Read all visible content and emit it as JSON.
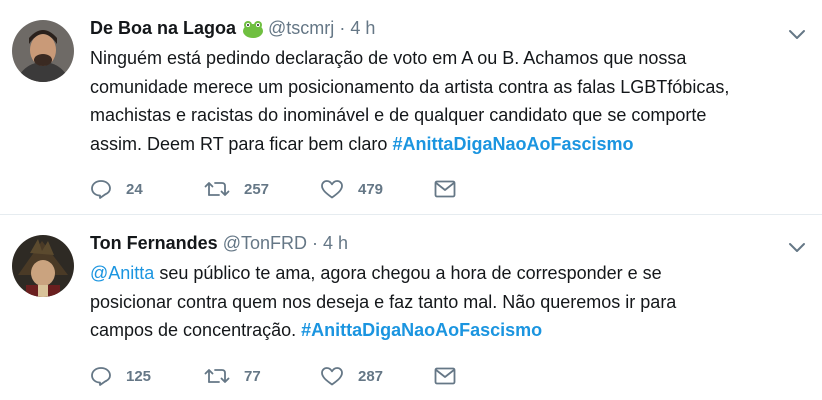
{
  "tweets": [
    {
      "name": "De Boa na Lagoa",
      "handle": "@tscmrj",
      "dot": "·",
      "time": "4 h",
      "lines": [
        "Ninguém está pedindo declaração de voto em A ou B. Achamos que nossa",
        "comunidade merece um posicionamento da artista contra as falas LGBTfóbicas,",
        "machistas e racistas do inominável e de qualquer candidato que se comporte"
      ],
      "last_line_prefix": "assim. Deem RT para ficar bem claro ",
      "hashtag": "#AnittaDigaNaoAoFascismo",
      "replies": "24",
      "retweets": "257",
      "likes": "479"
    },
    {
      "name": "Ton Fernandes",
      "handle": "@TonFRD",
      "dot": "·",
      "time": "4 h",
      "mention": "@Anitta",
      "line1_rest": " seu público te ama, agora chegou a hora de corresponder e se",
      "line2": "posicionar contra quem nos deseja e faz tanto mal. Não queremos ir para",
      "last_line_prefix": "campos de concentração. ",
      "hashtag": "#AnittaDigaNaoAoFascismo",
      "replies": "125",
      "retweets": "77",
      "likes": "287"
    }
  ],
  "colors": {
    "link": "#1b95e0",
    "muted": "#657786",
    "text": "#14171a",
    "divider": "#e6ecf0"
  },
  "icons": [
    "frog-emoji-icon",
    "chevron-down-icon",
    "reply-icon",
    "retweet-icon",
    "like-icon",
    "message-icon"
  ]
}
